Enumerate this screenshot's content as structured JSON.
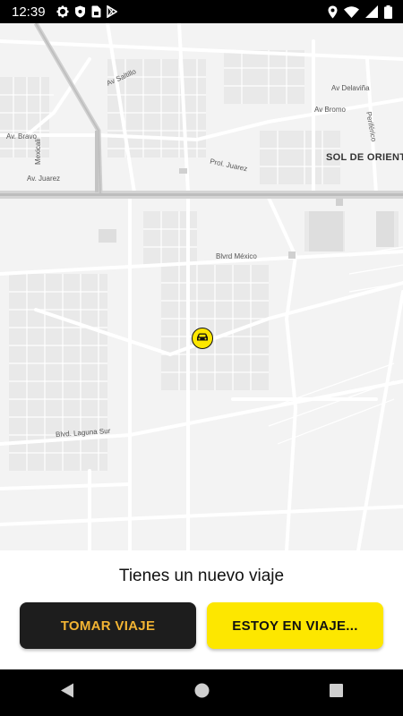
{
  "status_bar": {
    "time": "12:39",
    "left_icons": [
      "gear-icon",
      "shield-icon",
      "sim-card-icon",
      "play-store-icon"
    ],
    "right_icons": [
      "location-icon",
      "wifi-icon",
      "signal-icon",
      "battery-icon"
    ]
  },
  "map": {
    "labels": {
      "av_saltillo": "Av Saltillo",
      "av_delavina": "Av Delaviña",
      "av_bromo": "Av Bromo",
      "periferico": "Periférico",
      "av_bravo": "Av. Bravo",
      "mexicali": "Mexicali",
      "av_juarez": "Av. Juarez",
      "prol_juarez": "Prol. Juarez",
      "sol_de_oriente": "SOL DE ORIENT",
      "blvd_mexico": "Blvrd México",
      "blvd_laguna_sur": "Blvd. Laguna Sur"
    },
    "marker_icon": "car-icon",
    "colors": {
      "marker": "#fde700",
      "roads": "#ffffff",
      "highway": "#cfcfcf",
      "background": "#f3f3f3"
    }
  },
  "panel": {
    "title": "Tienes un nuevo viaje",
    "take_trip_label": "TOMAR VIAJE",
    "on_trip_label": "ESTOY EN VIAJE...",
    "colors": {
      "take_bg": "#1d1d1d",
      "take_text": "#f2b433",
      "on_trip_bg": "#fde700",
      "on_trip_text": "#111111"
    }
  },
  "nav_bar": {
    "icons": [
      "back-icon",
      "home-icon",
      "recents-icon"
    ]
  }
}
